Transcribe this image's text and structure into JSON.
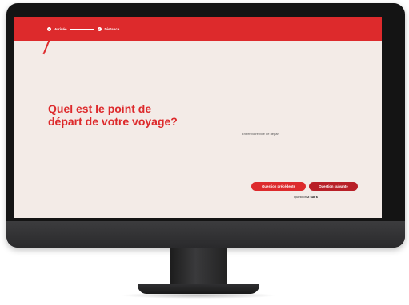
{
  "progress": {
    "steps": [
      {
        "label": "Arrivée",
        "done": true
      },
      {
        "label": "Distance",
        "done": true
      },
      {
        "label": "",
        "done": false
      },
      {
        "label": "",
        "done": false
      },
      {
        "label": "",
        "done": false
      },
      {
        "label": "",
        "done": false
      }
    ]
  },
  "main": {
    "question_line1": "Quel est le point de",
    "question_line2": "départ de votre voyage?",
    "input_placeholder": "Entrer votre ville de départ"
  },
  "nav": {
    "prev_label": "Question précédente",
    "next_label": "Question suivante",
    "counter_prefix": "Question",
    "counter_value": "2 sur 6"
  },
  "colors": {
    "accent": "#dd2a2c",
    "accent_dark": "#b81f27",
    "background": "#f3ebe7"
  }
}
